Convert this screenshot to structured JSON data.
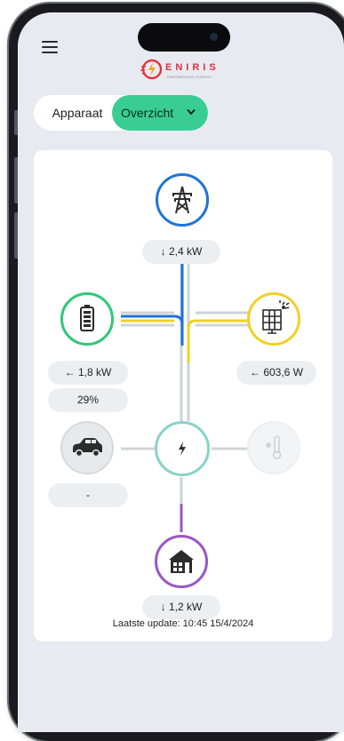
{
  "header": {
    "menu_icon": "hamburger-menu-icon",
    "logo": {
      "name": "ENIRIS",
      "tagline": "EMPOWERING ENERGY"
    }
  },
  "view_toggle": {
    "options": [
      "Apparaat",
      "Overzicht"
    ],
    "selected": "Overzicht"
  },
  "energy_flow": {
    "grid": {
      "icon": "power-pylon-icon",
      "value": "↓ 2,4 kW",
      "color": "#1f73d6"
    },
    "battery": {
      "icon": "battery-icon",
      "value": "← 1,8 kW",
      "charge": "29%",
      "color": "#2dc876"
    },
    "solar": {
      "icon": "solar-panel-icon",
      "value": "← 603,6 W",
      "color": "#f2d024"
    },
    "car": {
      "icon": "car-icon",
      "value": "-"
    },
    "hub": {
      "icon": "lightning-bolt-icon",
      "color": "#86d4c9"
    },
    "heating": {
      "icon": "thermometer-snowflake-icon"
    },
    "home": {
      "icon": "house-icon",
      "value": "↓ 1,2 kW",
      "color": "#9a56c8"
    }
  },
  "last_update": "Laatste update: 10:45 15/4/2024"
}
